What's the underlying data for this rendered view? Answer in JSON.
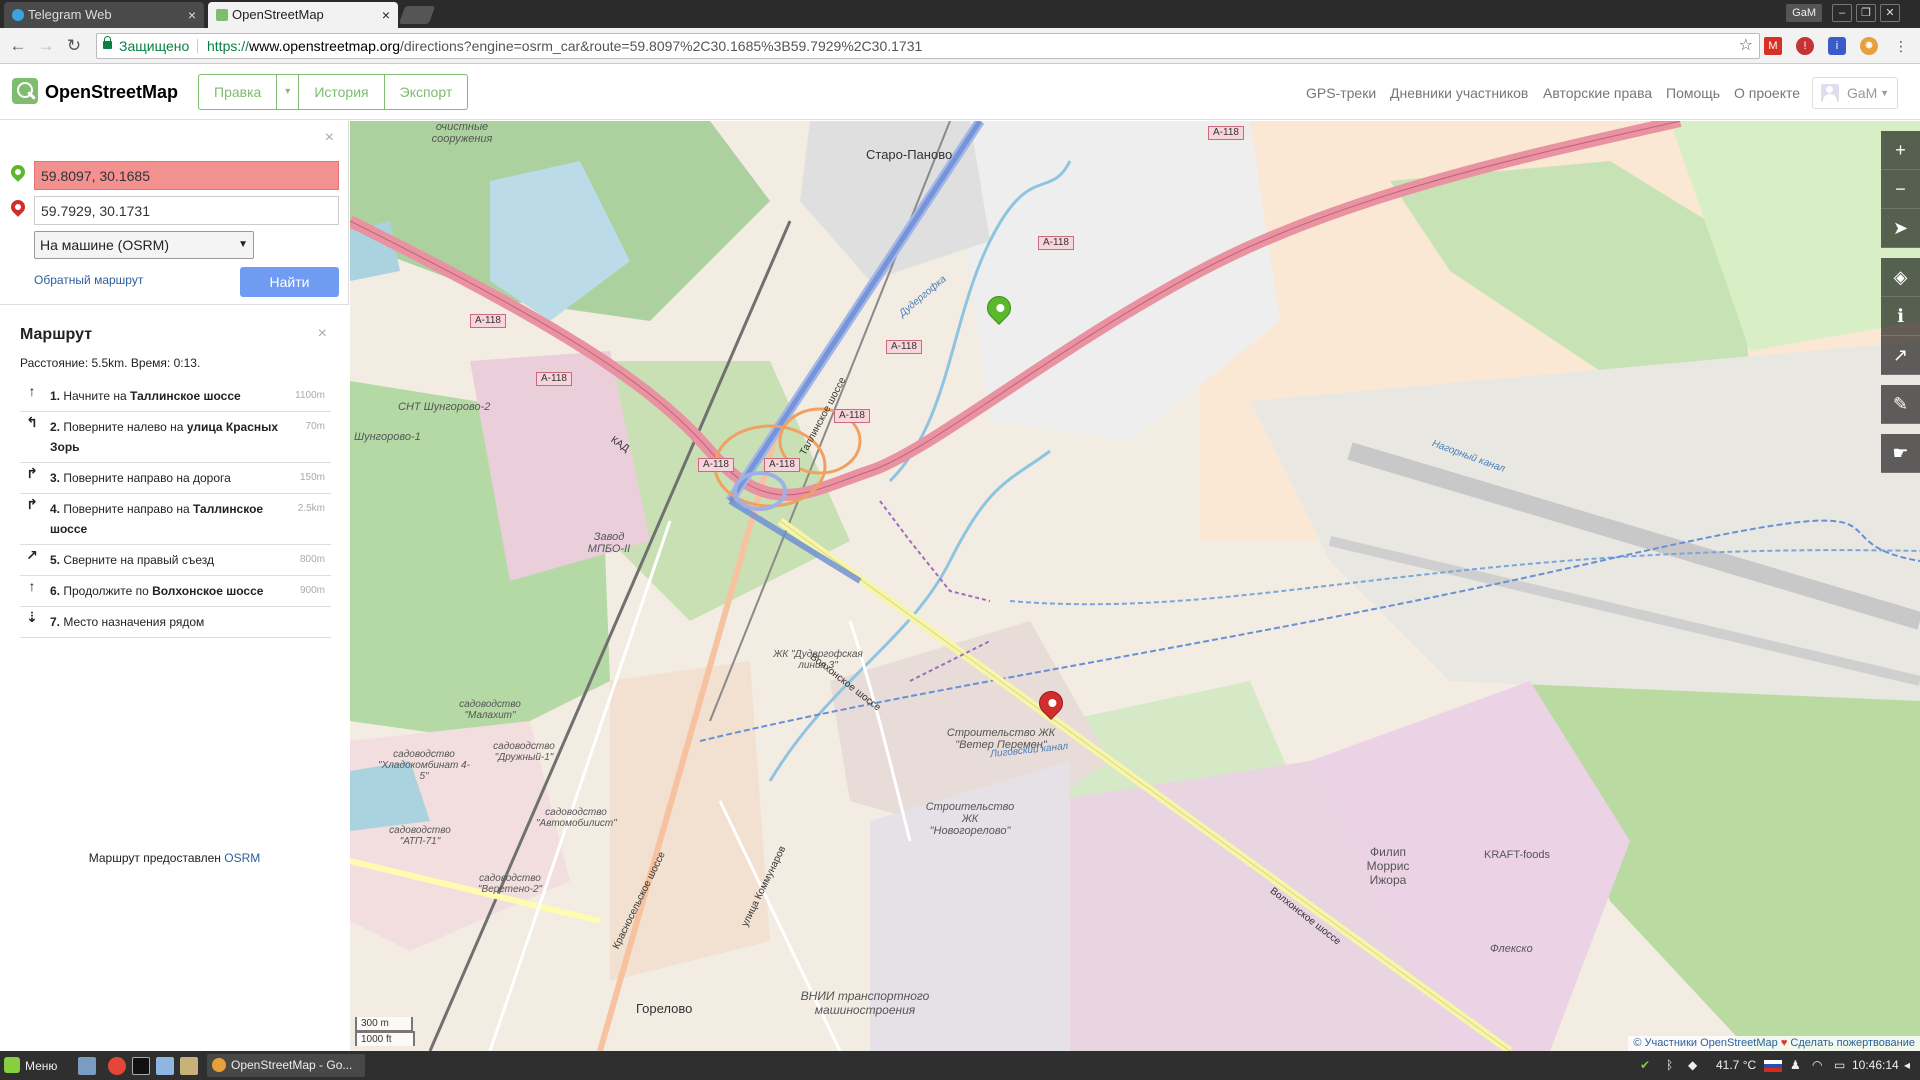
{
  "browser": {
    "tabs": [
      {
        "label": "Telegram Web",
        "active": false
      },
      {
        "label": "OpenStreetMap",
        "active": true
      }
    ],
    "window_user": "GaM",
    "secure_label": "Защищено",
    "url": {
      "scheme": "https://",
      "host": "www.openstreetmap.org",
      "path": "/directions?engine=osrm_car&route=59.8097%2C30.1685%3B59.7929%2C30.1731"
    }
  },
  "header": {
    "title": "OpenStreetMap",
    "edit_buttons": {
      "edit": "Правка",
      "history": "История",
      "export": "Экспорт"
    },
    "nav": [
      "GPS-треки",
      "Дневники участников",
      "Авторские права",
      "Помощь",
      "О проекте"
    ],
    "user": "GaM"
  },
  "directions": {
    "from_value": "59.8097, 30.1685",
    "to_value": "59.7929, 30.1731",
    "engine": "На машине (OSRM)",
    "reverse_label": "Обратный маршрут",
    "find_label": "Найти"
  },
  "route": {
    "title": "Маршрут",
    "summary": "Расстояние: 5.5km. Время: 0:13.",
    "steps": [
      {
        "icon": "straight-arrow-icon",
        "glyph": "↑",
        "num": "1.",
        "text": "Начните на",
        "bold": "Таллинское шоссе",
        "distance": "1100m"
      },
      {
        "icon": "turn-left-icon",
        "glyph": "↰",
        "num": "2.",
        "text": "Поверните налево на",
        "bold": "улица Красных Зорь",
        "distance": "70m"
      },
      {
        "icon": "turn-right-icon",
        "glyph": "↱",
        "num": "3.",
        "text": "Поверните направо на дорога",
        "bold": "",
        "distance": "150m"
      },
      {
        "icon": "turn-right-icon",
        "glyph": "↱",
        "num": "4.",
        "text": "Поверните направо на",
        "bold": "Таллинское шоссе",
        "distance": "2.5km"
      },
      {
        "icon": "slight-right-icon",
        "glyph": "↗",
        "num": "5.",
        "text": "Сверните на правый съезд",
        "bold": "",
        "distance": "800m"
      },
      {
        "icon": "straight-arrow-icon",
        "glyph": "↑",
        "num": "6.",
        "text": "Продолжите по",
        "bold": "Волхонское шоссе",
        "distance": "900m"
      },
      {
        "icon": "destination-icon",
        "glyph": "⇣",
        "num": "7.",
        "text": "Место назначения рядом",
        "bold": "",
        "distance": ""
      }
    ],
    "credit_text": "Маршрут предоставлен",
    "credit_link": "OSRM"
  },
  "map": {
    "labels": {
      "staro_panovo": "Старо-Паново",
      "gorelovo": "Горелово",
      "sewage": "очистные сооружения",
      "snt": "СНТ Шунгорово-2",
      "shungorovo": "Шунгорово-1",
      "zavod": "Завод МПБО-II",
      "filip": "Филип Моррис Ижора",
      "vnii": "ВНИИ транспортного машиностроения",
      "kraft": "KRAFT-foods",
      "fleko": "Флекско",
      "zhk_vetер": "Строительство ЖК \"Ветер Перемен\"",
      "zhk_novogorelovo": "Строительство ЖК \"Новогорелово\"",
      "zhk_duder": "ЖК \"Дудергофская линия 3\"",
      "molaxit": "садоводство \"Малахит\"",
      "xlado": "садоводство \"Хладокомбинат 4-5\"",
      "druzhny": "садоводство \"Дружный-1\"",
      "avtomob": "садоводство \"Автомобилист\"",
      "atp": "садоводство \"АТП-71\"",
      "veretено": "садоводство \"Веретено-2\"",
      "tallinskoe": "Таллинское шоссе",
      "volhonskoe": "Волхонское шоссе",
      "volhonskoe2": "Волхонское шоссе",
      "krasnoselskoe": "Красносельское шоссе",
      "kommunarov": "улица Коммунаров",
      "duderhofka": "Дудергофка",
      "ligovsky": "Лиговский канал",
      "nagorny": "Нагорный канал",
      "kad": "КАД"
    },
    "shields": [
      "А-118",
      "А-118",
      "А-118",
      "А-118",
      "А-118",
      "А-118",
      "А-118",
      "А-118"
    ],
    "scale_metric": "300 m",
    "scale_imperial": "1000 ft",
    "attribution_link1": "© Участники OpenStreetMap",
    "attribution_heart": "♥",
    "attribution_link2": "Сделать пожертвование"
  },
  "taskbar": {
    "menu": "Меню",
    "task_label": "OpenStreetMap - Go...",
    "temperature": "41.7 °C",
    "time": "10:46:14"
  },
  "colors": {
    "osm_green": "#7ebc6f",
    "find_button": "#6f9cf2",
    "from_field": "#f39090",
    "motorway": "#e892a2",
    "route": "#6b8dd6"
  }
}
